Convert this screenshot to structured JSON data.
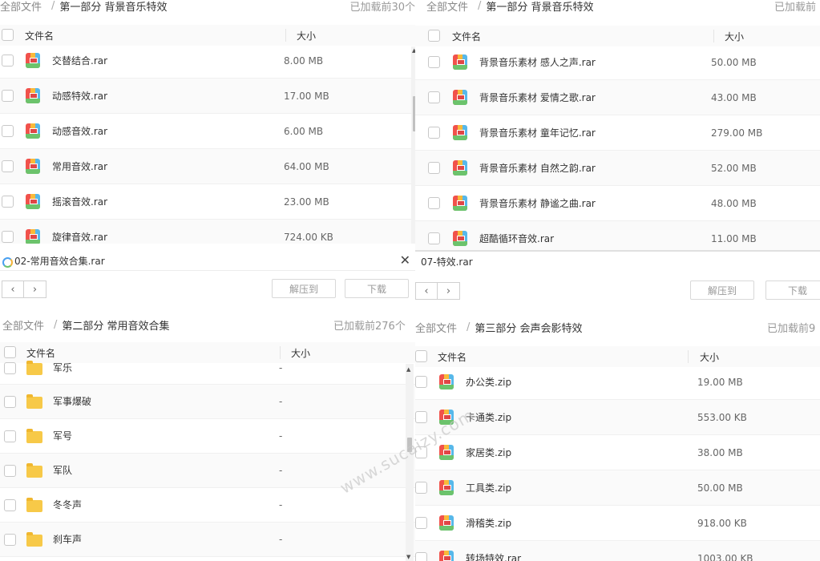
{
  "panel1": {
    "breadcrumb": {
      "root": "全部文件",
      "current": "第一部分 背景音乐特效",
      "loaded": "已加载前30个"
    },
    "header": {
      "name": "文件名",
      "size": "大小"
    },
    "rows": [
      {
        "name": "交替结合.rar",
        "size": "8.00 MB"
      },
      {
        "name": "动感特效.rar",
        "size": "17.00 MB"
      },
      {
        "name": "动感音效.rar",
        "size": "6.00 MB"
      },
      {
        "name": "常用音效.rar",
        "size": "64.00 MB"
      },
      {
        "name": "摇滚音效.rar",
        "size": "23.00 MB"
      },
      {
        "name": "旋律音效.rar",
        "size": "724.00 KB"
      }
    ]
  },
  "panel2": {
    "breadcrumb": {
      "root": "全部文件",
      "current": "第一部分 背景音乐特效",
      "loaded": "已加载前"
    },
    "header": {
      "name": "文件名",
      "size": "大小"
    },
    "rows": [
      {
        "name": "背景音乐素材 感人之声.rar",
        "size": "50.00 MB"
      },
      {
        "name": "背景音乐素材 爱情之歌.rar",
        "size": "43.00 MB"
      },
      {
        "name": "背景音乐素材 童年记忆.rar",
        "size": "279.00 MB"
      },
      {
        "name": "背景音乐素材 自然之韵.rar",
        "size": "52.00 MB"
      },
      {
        "name": "背景音乐素材 静谧之曲.rar",
        "size": "48.00 MB"
      },
      {
        "name": "超酷循环音效.rar",
        "size": "11.00 MB"
      }
    ]
  },
  "panel3": {
    "window_title": "02-常用音效合集.rar",
    "buttons": {
      "extract": "解压到",
      "download": "下载"
    },
    "breadcrumb": {
      "root": "全部文件",
      "current": "第二部分 常用音效合集",
      "loaded": "已加载前276个"
    },
    "header": {
      "name": "文件名",
      "size": "大小"
    },
    "rows": [
      {
        "name": "军乐",
        "size": "-"
      },
      {
        "name": "军事爆破",
        "size": "-"
      },
      {
        "name": "军号",
        "size": "-"
      },
      {
        "name": "军队",
        "size": "-"
      },
      {
        "name": "冬冬声",
        "size": "-"
      },
      {
        "name": "刹车声",
        "size": "-"
      }
    ]
  },
  "panel4": {
    "window_title": "07-特效.rar",
    "buttons": {
      "extract": "解压到",
      "download": "下载"
    },
    "breadcrumb": {
      "root": "全部文件",
      "current": "第三部分 会声会影特效",
      "loaded": "已加载前9"
    },
    "header": {
      "name": "文件名",
      "size": "大小"
    },
    "rows": [
      {
        "name": "办公类.zip",
        "size": "19.00 MB"
      },
      {
        "name": "卡通类.zip",
        "size": "553.00 KB"
      },
      {
        "name": "家居类.zip",
        "size": "38.00 MB"
      },
      {
        "name": "工具类.zip",
        "size": "50.00 MB"
      },
      {
        "name": "滑稽类.zip",
        "size": "918.00 KB"
      },
      {
        "name": "转场特效.rar",
        "size": "1003.00 KB"
      }
    ]
  },
  "nav": {
    "back": "‹",
    "forward": "›",
    "close": "✕"
  },
  "watermark": "www.sucaizy.com",
  "colors": {
    "accent": "#4aa0f0",
    "muted_text": "#999999",
    "border": "#d8d8d8"
  }
}
